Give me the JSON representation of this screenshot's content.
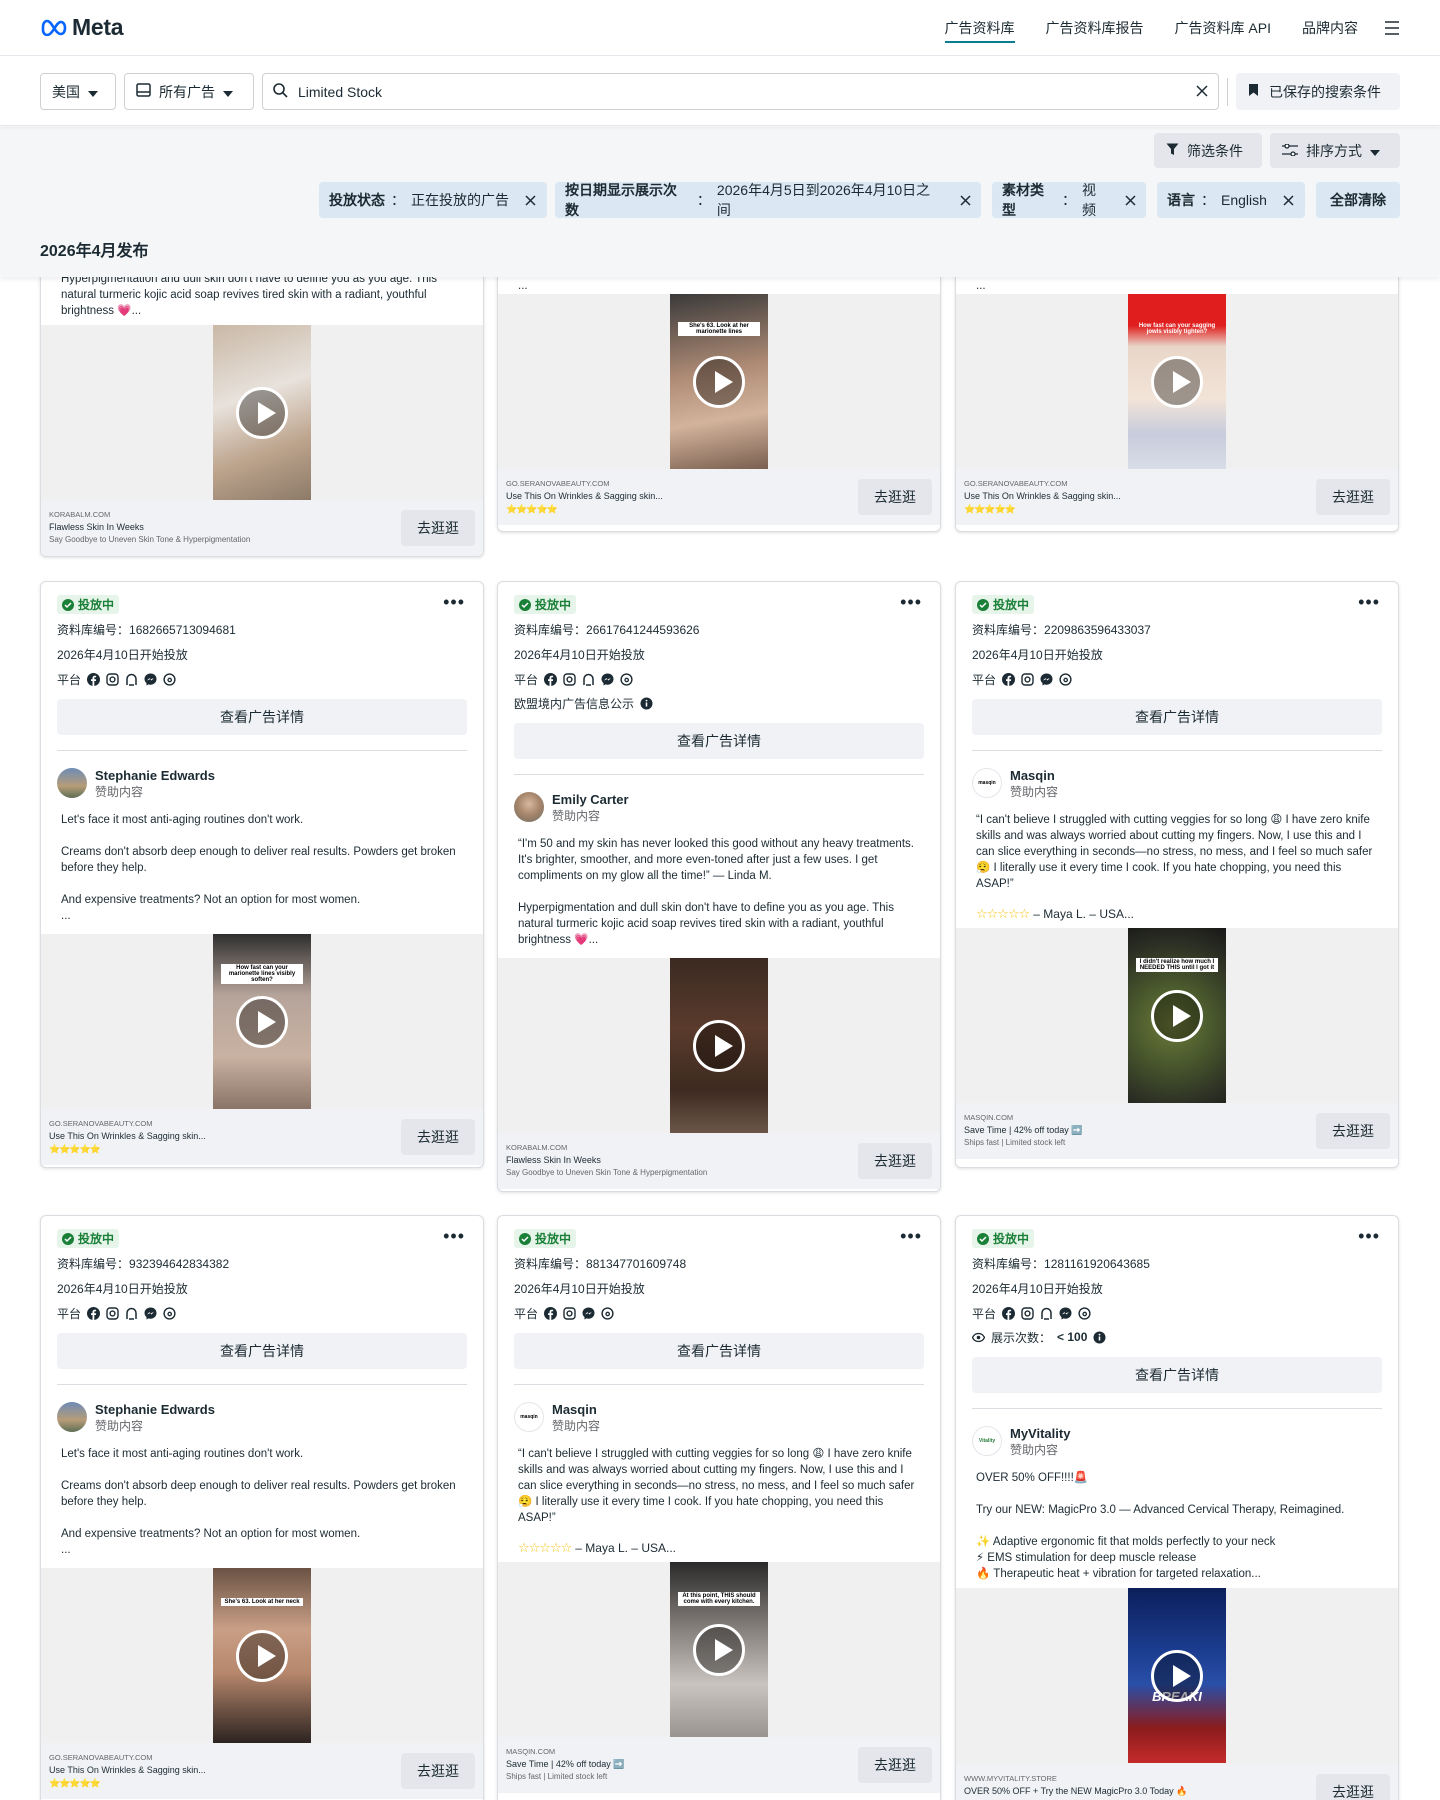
{
  "brand": {
    "name": "Meta"
  },
  "nav": {
    "links": [
      "广告资料库",
      "广告资料库报告",
      "广告资料库 API",
      "品牌内容"
    ],
    "active_index": 0
  },
  "search": {
    "country": "美国",
    "ad_category": "所有广告",
    "query": "Limited Stock",
    "saved_label": "已保存的搜索条件"
  },
  "toolbar": {
    "filter_label": "筛选条件",
    "sort_label": "排序方式"
  },
  "chips": [
    {
      "key": "投放状态",
      "value": "正在投放的广告"
    },
    {
      "key": "按日期显示展示次数",
      "value": "2026年4月5日到2026年4月10日之间"
    },
    {
      "key": "素材类型",
      "value": "视频"
    },
    {
      "key": "语言",
      "value": "English"
    }
  ],
  "clear_all": "全部清除",
  "section_title": "2026年4月发布",
  "labels": {
    "status": "投放中",
    "library_id_prefix": "资料库编号：",
    "platform": "平台",
    "detail_button": "查看广告详情",
    "sponsored": "赞助内容",
    "shop_button": "去逛逛",
    "eu_info": "欧盟境内广告信息公示",
    "impressions_label": "展示次数：",
    "impressions_value": "< 100"
  },
  "partial_cards": [
    {
      "text": "Hyperpigmentation and dull skin don't have to define you as you age. This natural turmeric kojic acid soap revives tired skin with a radiant, youthful brightness 💗...",
      "domain": "KORABALM.COM",
      "title": "Flawless Skin In Weeks",
      "subtitle": "Say Goodbye to Uneven Skin Tone & Hyperpigmentation",
      "stars": ""
    },
    {
      "text": "...",
      "overlay": "She's 63. Look at her marionette lines",
      "domain": "GO.SERANOVABEAUTY.COM",
      "title": "Use This On Wrinkles & Sagging skin...",
      "subtitle": "",
      "stars": "⭐⭐⭐⭐⭐"
    },
    {
      "text": "...",
      "overlay": "How fast can your sagging jowls visibly tighten?",
      "domain": "GO.SERANOVABEAUTY.COM",
      "title": "Use This On Wrinkles & Sagging skin...",
      "subtitle": "",
      "stars": "⭐⭐⭐⭐⭐"
    }
  ],
  "cards": [
    {
      "library_id": "1682665713094681",
      "start_date": "2026年4月10日开始投放",
      "advertiser": "Stephanie Edwards",
      "text": "Let's face it most anti-aging routines don't work.\n\nCreams don't absorb deep enough to deliver real results. Powders get broken before they help.\n\nAnd expensive treatments? Not an option for most women.\n...",
      "overlay": "How fast can your marionette lines visibly soften?",
      "domain": "GO.SERANOVABEAUTY.COM",
      "title": "Use This On Wrinkles & Sagging skin...",
      "subtitle": "",
      "stars": "⭐⭐⭐⭐⭐"
    },
    {
      "library_id": "26617641244593626",
      "start_date": "2026年4月10日开始投放",
      "advertiser": "Emily Carter",
      "text": "“I'm 50 and my skin has never looked this good without any heavy treatments. It's brighter, smoother, and more even-toned after just a few uses. I get compliments on my glow all the time!” — Linda M.\n\nHyperpigmentation and dull skin don't have to define you as you age. This natural turmeric kojic acid soap revives tired skin with a radiant, youthful brightness 💗...",
      "domain": "KORABALM.COM",
      "title": "Flawless Skin In Weeks",
      "subtitle": "Say Goodbye to Uneven Skin Tone & Hyperpigmentation",
      "stars": ""
    },
    {
      "library_id": "2209863596433037",
      "start_date": "2026年4月10日开始投放",
      "advertiser": "Masqin",
      "text": "“I can't believe I struggled with cutting veggies for so long 😩 I have zero knife skills and was always worried about cutting my fingers. Now, I use this and I can slice everything in seconds—no stress, no mess, and I feel so much safer 😮‍💨 I literally use it every time I cook. If you hate chopping, you need this ASAP!”",
      "stars_line": "– Maya L. – USA...",
      "overlay": "I didn't realize how much I NEEDED THIS until I got it",
      "domain": "MASQIN.COM",
      "title": "Save Time | 42% off today ➡️",
      "subtitle": "Ships fast | Limited stock left",
      "stars": ""
    },
    {
      "library_id": "932394642834382",
      "start_date": "2026年4月10日开始投放",
      "advertiser": "Stephanie Edwards",
      "text": "Let's face it most anti-aging routines don't work.\n\nCreams don't absorb deep enough to deliver real results. Powders get broken before they help.\n\nAnd expensive treatments? Not an option for most women.\n...",
      "overlay": "She's 63. Look at her neck",
      "domain": "GO.SERANOVABEAUTY.COM",
      "title": "Use This On Wrinkles & Sagging skin...",
      "subtitle": "",
      "stars": "⭐⭐⭐⭐⭐"
    },
    {
      "library_id": "881347701609748",
      "start_date": "2026年4月10日开始投放",
      "advertiser": "Masqin",
      "text": "“I can't believe I struggled with cutting veggies for so long 😩 I have zero knife skills and was always worried about cutting my fingers. Now, I use this and I can slice everything in seconds—no stress, no mess, and I feel so much safer 😮‍💨 I literally use it every time I cook. If you hate chopping, you need this ASAP!”",
      "stars_line": "– Maya L. – USA...",
      "overlay": "At this point, THIS should come with every kitchen.",
      "domain": "MASQIN.COM",
      "title": "Save Time | 42% off today ➡️",
      "subtitle": "Ships fast | Limited stock left",
      "stars": ""
    },
    {
      "library_id": "1281161920643685",
      "start_date": "2026年4月10日开始投放",
      "advertiser": "MyVitality",
      "text": "OVER 50% OFF!!!!🚨\n\nTry our NEW: MagicPro 3.0 — Advanced Cervical Therapy, Reimagined.\n\n✨ Adaptive ergonomic fit that molds perfectly to your neck\n⚡ EMS stimulation for deep muscle release\n🔥 Therapeutic heat + vibration for targeted relaxation...",
      "overlay": "BREAKI",
      "domain": "WWW.MYVITALITY.STORE",
      "title": "OVER 50% OFF + Try the NEW MagicPro 3.0 Today 🔥",
      "subtitle": "",
      "stars": ""
    }
  ],
  "colors": {
    "accent": "#0a7e8c",
    "status_green": "#1a7f37",
    "chip_bg": "#dbe7f2"
  }
}
